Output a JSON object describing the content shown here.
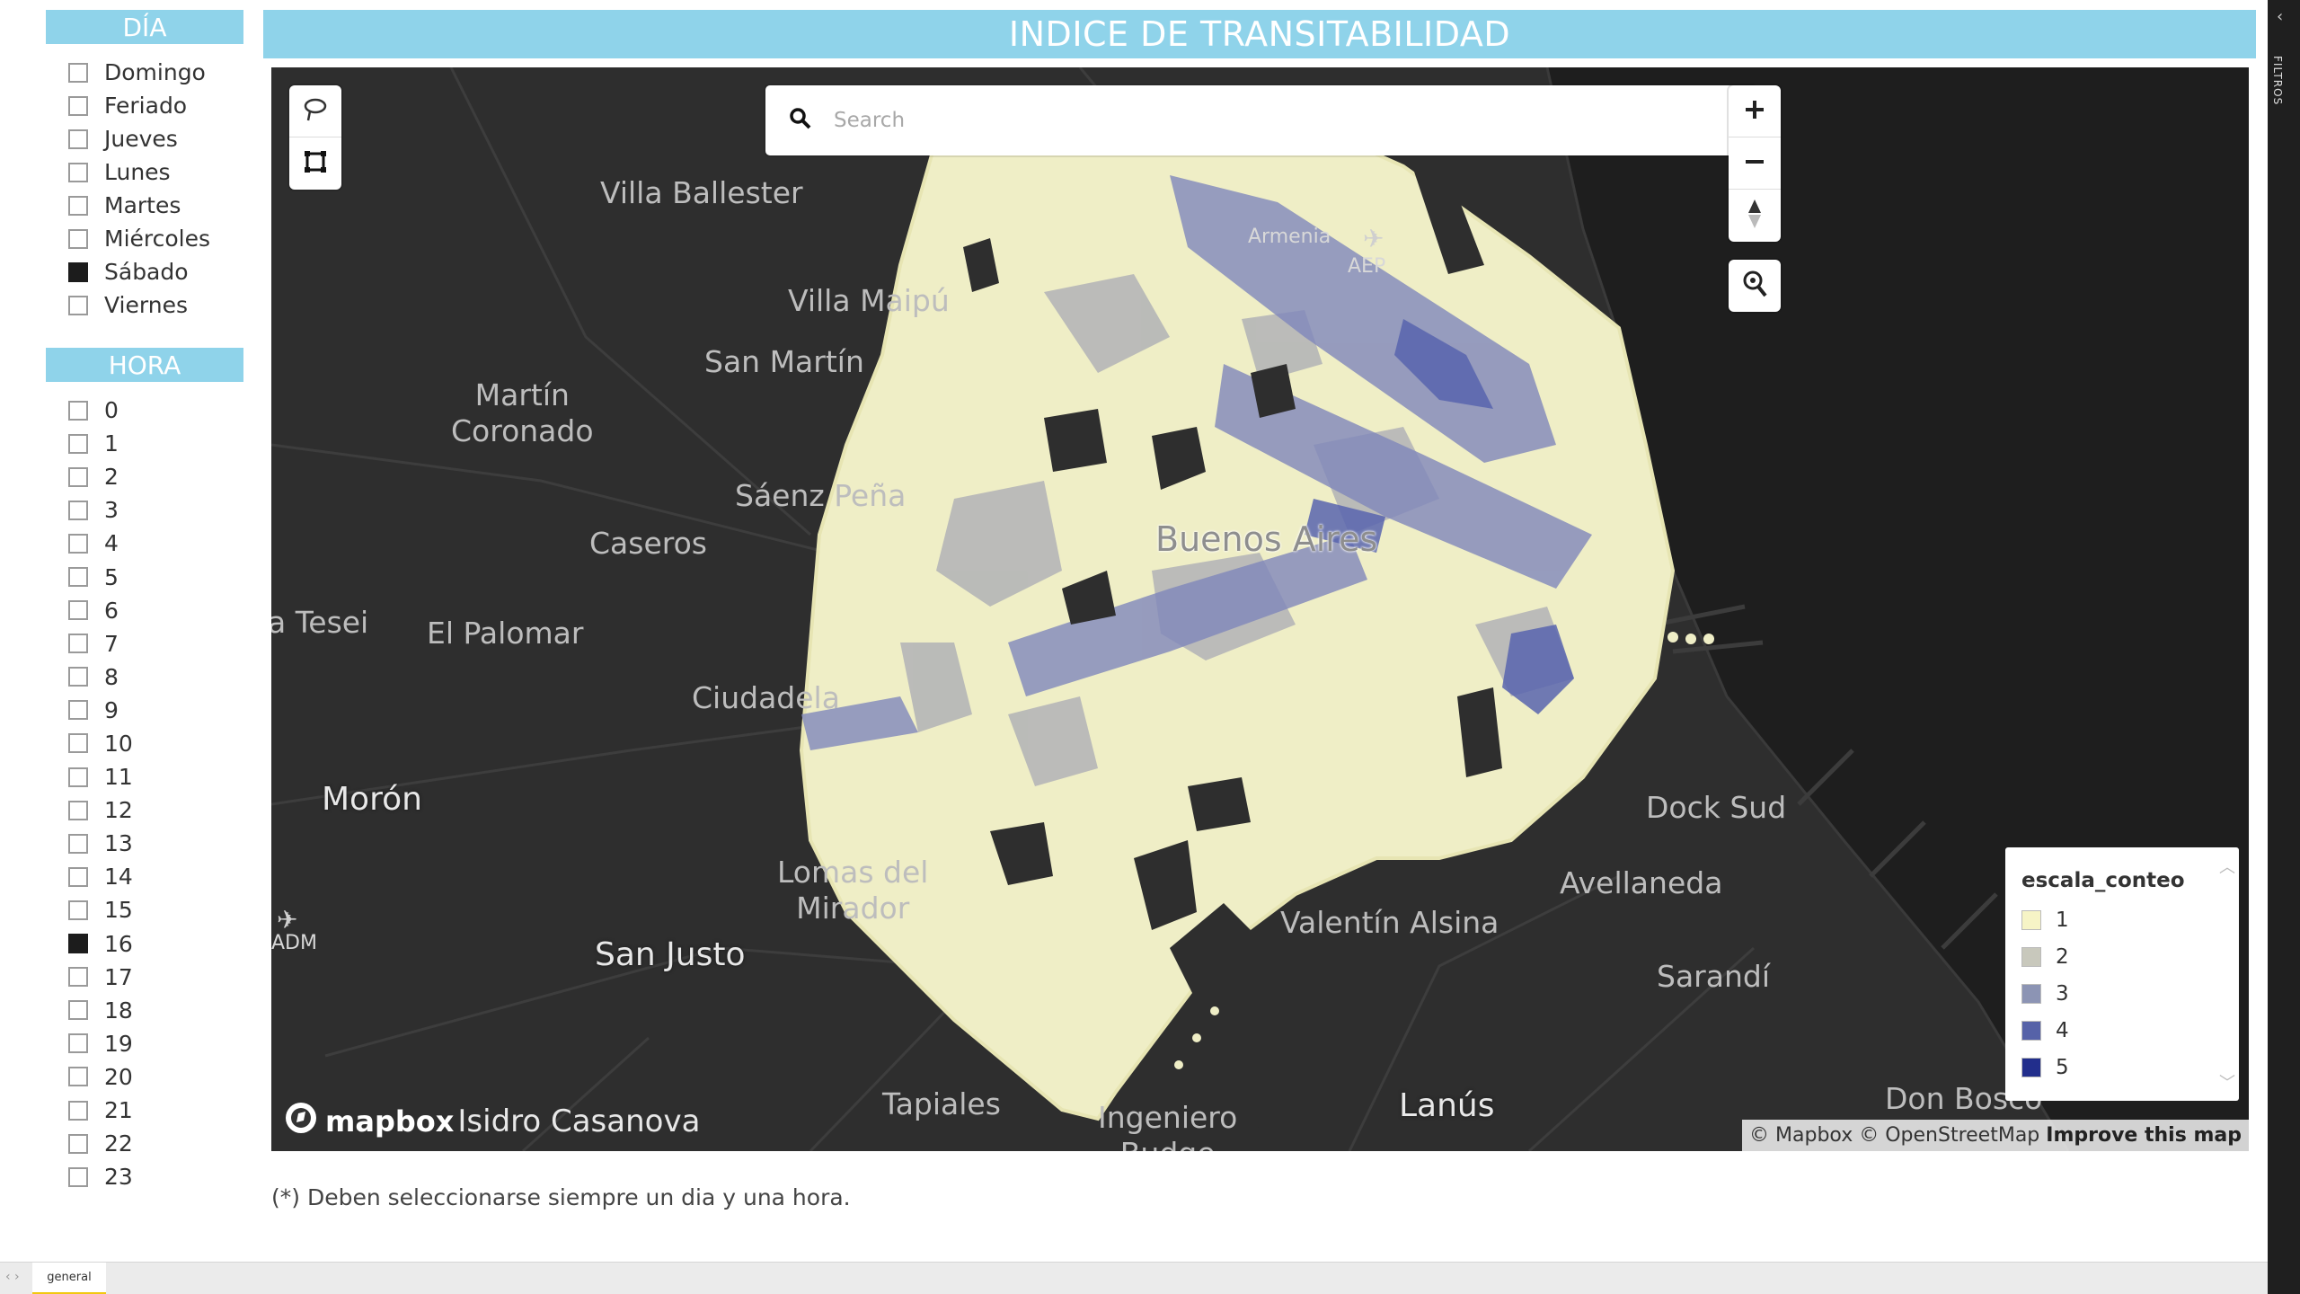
{
  "day_filter": {
    "header": "DÍA",
    "items": [
      {
        "label": "Domingo",
        "checked": false
      },
      {
        "label": "Feriado",
        "checked": false
      },
      {
        "label": "Jueves",
        "checked": false
      },
      {
        "label": "Lunes",
        "checked": false
      },
      {
        "label": "Martes",
        "checked": false
      },
      {
        "label": "Miércoles",
        "checked": false
      },
      {
        "label": "Sábado",
        "checked": true
      },
      {
        "label": "Viernes",
        "checked": false
      }
    ]
  },
  "hour_filter": {
    "header": "HORA",
    "items": [
      {
        "label": "0",
        "checked": false
      },
      {
        "label": "1",
        "checked": false
      },
      {
        "label": "2",
        "checked": false
      },
      {
        "label": "3",
        "checked": false
      },
      {
        "label": "4",
        "checked": false
      },
      {
        "label": "5",
        "checked": false
      },
      {
        "label": "6",
        "checked": false
      },
      {
        "label": "7",
        "checked": false
      },
      {
        "label": "8",
        "checked": false
      },
      {
        "label": "9",
        "checked": false
      },
      {
        "label": "10",
        "checked": false
      },
      {
        "label": "11",
        "checked": false
      },
      {
        "label": "12",
        "checked": false
      },
      {
        "label": "13",
        "checked": false
      },
      {
        "label": "14",
        "checked": false
      },
      {
        "label": "15",
        "checked": false
      },
      {
        "label": "16",
        "checked": true
      },
      {
        "label": "17",
        "checked": false
      },
      {
        "label": "18",
        "checked": false
      },
      {
        "label": "19",
        "checked": false
      },
      {
        "label": "20",
        "checked": false
      },
      {
        "label": "21",
        "checked": false
      },
      {
        "label": "22",
        "checked": false
      },
      {
        "label": "23",
        "checked": false
      }
    ]
  },
  "title": "INDICE DE TRANSITABILIDAD",
  "map": {
    "search_placeholder": "Search",
    "places": {
      "villa_ballester": "Villa Ballester",
      "villa_maipu": "Villa Maipú",
      "san_martin": "San Martín",
      "martin_coronado": "Martín\nCoronado",
      "saenz_pena": "Sáenz Peña",
      "caseros": "Caseros",
      "tesei": "a Tesei",
      "el_palomar": "El Palomar",
      "ciudadela": "Ciudadela",
      "moron": "Morón",
      "lomas_del_mirador": "Lomas del\nMirador",
      "san_justo": "San Justo",
      "tapiales": "Tapiales",
      "ingeniero_budge": "Ingeniero\nBudge",
      "isidro_casanova": "Isidro Casanova",
      "lanus": "Lanús",
      "valentin_alsina": "Valentín Alsina",
      "avellaneda": "Avellaneda",
      "dock_sud": "Dock Sud",
      "sarandi": "Sarandí",
      "don_bosco": "Don Bosco",
      "buenos_aires": "Buenos Aires",
      "armenia": "Armenia",
      "aep": "AEP",
      "adm": "ADM"
    },
    "legend": {
      "title": "escala_conteo",
      "items": [
        {
          "label": "1",
          "color": "#f6f4c6"
        },
        {
          "label": "2",
          "color": "#c8c8bc"
        },
        {
          "label": "3",
          "color": "#8c94b4"
        },
        {
          "label": "4",
          "color": "#5662a8"
        },
        {
          "label": "5",
          "color": "#222e8c"
        }
      ]
    },
    "brand": "mapbox",
    "attribution": {
      "mapbox": "© Mapbox",
      "osm": "© OpenStreetMap",
      "improve": "Improve this map"
    }
  },
  "footnote": "(*) Deben seleccionarse siempre un dia y una hora.",
  "filters_pane_label": "FILTROS",
  "tab": "general"
}
